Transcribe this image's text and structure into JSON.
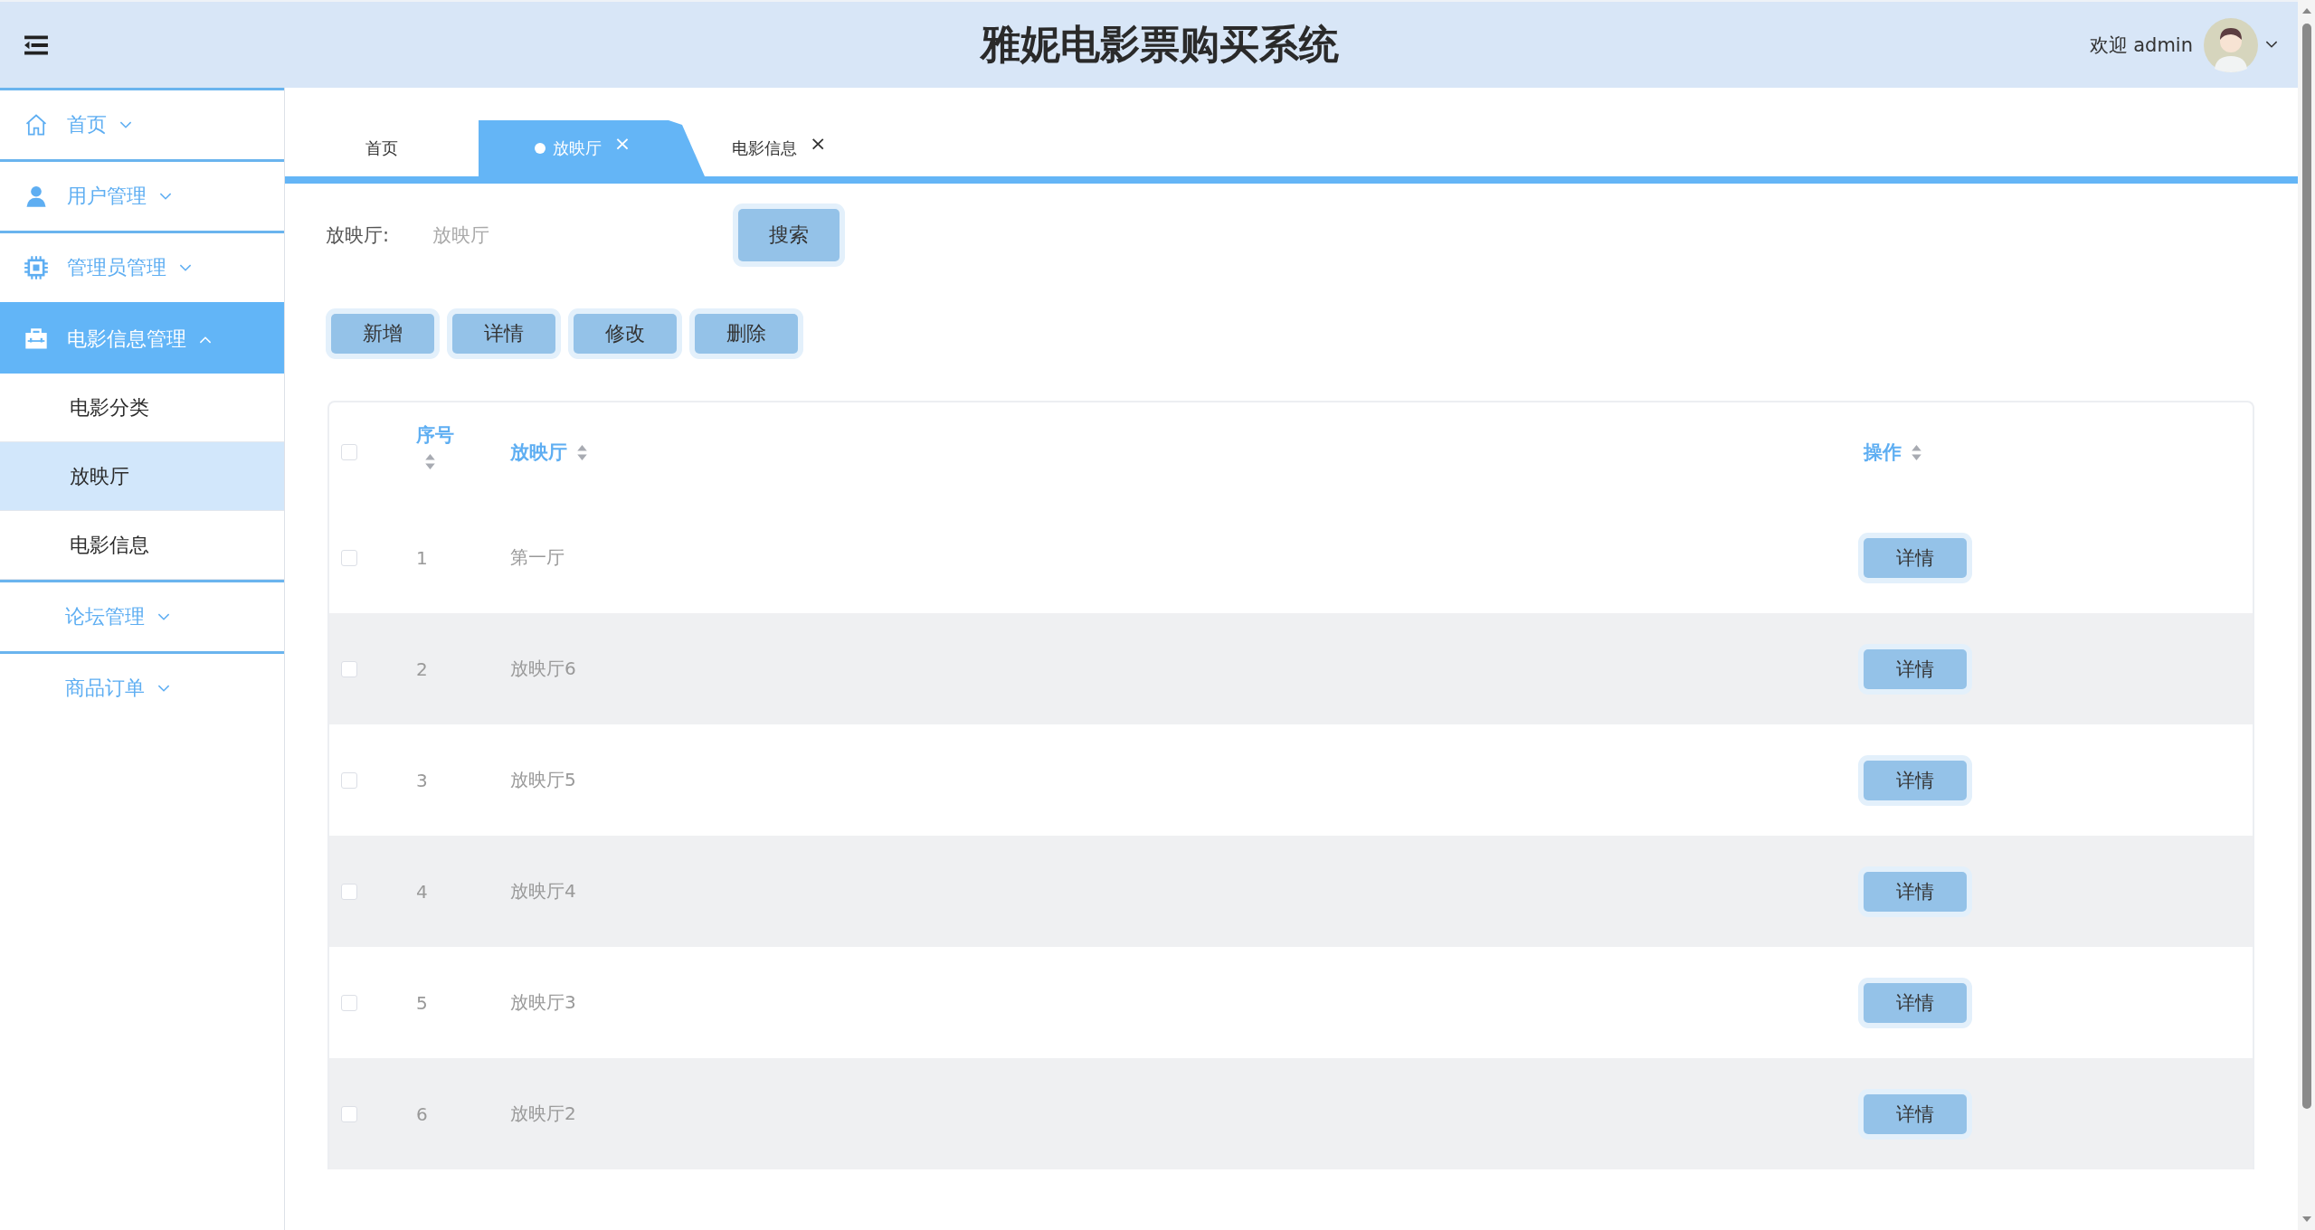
{
  "header": {
    "title": "雅妮电影票购买系统",
    "welcome": "欢迎 admin"
  },
  "sidebar": {
    "items": [
      {
        "label": "首页",
        "expanded": false,
        "selected": false
      },
      {
        "label": "用户管理",
        "expanded": false,
        "selected": false
      },
      {
        "label": "管理员管理",
        "expanded": false,
        "selected": false
      },
      {
        "label": "电影信息管理",
        "expanded": true,
        "selected": true,
        "children": [
          {
            "label": "电影分类",
            "selected": false
          },
          {
            "label": "放映厅",
            "selected": true
          },
          {
            "label": "电影信息",
            "selected": false
          }
        ]
      },
      {
        "label": "论坛管理",
        "expanded": false,
        "selected": false
      },
      {
        "label": "商品订单",
        "expanded": false,
        "selected": false
      }
    ]
  },
  "tabs": [
    {
      "label": "首页",
      "selected": false
    },
    {
      "label": "放映厅",
      "selected": true,
      "close": "×"
    },
    {
      "label": "电影信息",
      "selected": false,
      "close": "×"
    }
  ],
  "search": {
    "label": "放映厅:",
    "placeholder": "放映厅",
    "button": "搜索"
  },
  "actions": [
    "新增",
    "详情",
    "修改",
    "删除"
  ],
  "table": {
    "header_checked": false,
    "columns": [
      "序号",
      "放映厅",
      "操作"
    ],
    "rows": [
      {
        "checked": false,
        "index": "1",
        "hall": "第一厅",
        "action": "详情"
      },
      {
        "checked": false,
        "index": "2",
        "hall": "放映厅6",
        "action": "详情"
      },
      {
        "checked": false,
        "index": "3",
        "hall": "放映厅5",
        "action": "详情"
      },
      {
        "checked": false,
        "index": "4",
        "hall": "放映厅4",
        "action": "详情"
      },
      {
        "checked": false,
        "index": "5",
        "hall": "放映厅3",
        "action": "详情"
      },
      {
        "checked": false,
        "index": "6",
        "hall": "放映厅2",
        "action": "详情"
      }
    ]
  }
}
